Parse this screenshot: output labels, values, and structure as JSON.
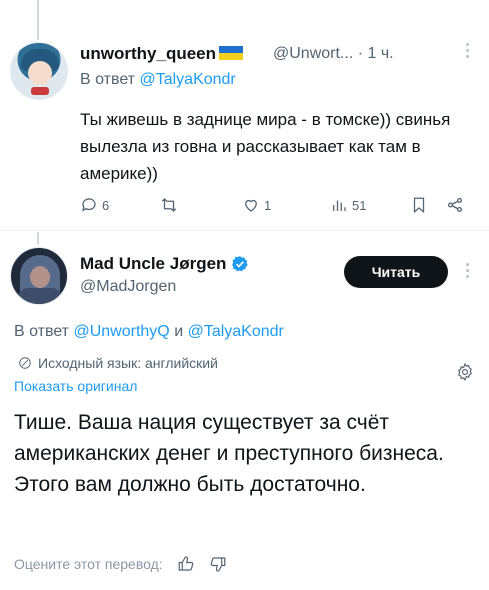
{
  "tweet1": {
    "name": "unworthy_queen",
    "handle": "@Unwort...",
    "time": "· 1 ч.",
    "reply_prefix": "В ответ",
    "reply_to": "@TalyaKondr",
    "text": "Ты живешь в заднице мира - в томске)) свинья вылезла из говна и рассказывает как там в америке))",
    "actions": {
      "replies": "6",
      "retweets": "",
      "likes": "1",
      "views": "51"
    },
    "flag_colors": [
      "#1f6fd1",
      "#f3cf1f"
    ]
  },
  "tweet2": {
    "name": "Mad Uncle Jørgen",
    "handle": "@MadJorgen",
    "follow_label": "Читать",
    "reply_prefix": "В ответ",
    "reply_to_1": "@UnworthyQ",
    "reply_conj": "и",
    "reply_to_2": "@TalyaKondr",
    "source_language": "Исходный язык: английский",
    "show_original": "Показать оригинал",
    "text": "Тише. Ваша нация существует за счёт американских денег и преступного бизнеса. Этого вам должно быть достаточно.",
    "rate_translation": "Оцените этот перевод:"
  },
  "colors": {
    "accent": "#1d9bf0",
    "text": "#0f1419",
    "secondary": "#536471",
    "button_bg": "#0f1419"
  },
  "icons": [
    "reply-icon",
    "retweet-icon",
    "like-icon",
    "views-icon",
    "bookmark-icon",
    "share-icon",
    "verified-badge-icon",
    "translate-icon",
    "gear-icon",
    "thumbs-up-icon",
    "thumbs-down-icon",
    "more-icon"
  ]
}
